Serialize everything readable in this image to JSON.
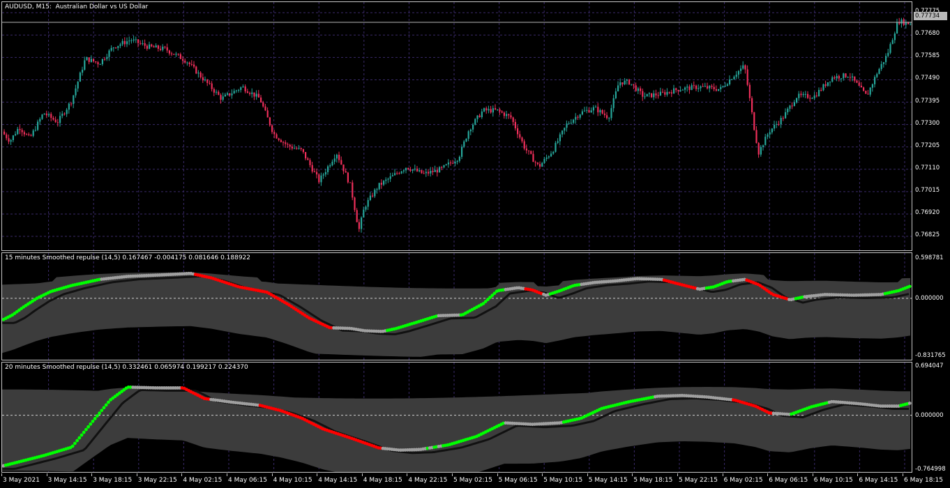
{
  "chart_window": {
    "symbol_caption": "AUDUSD, M15:  Australian Dollar vs US Dollar",
    "current_price": "0.77734",
    "price_scale": [
      "0.77775",
      "0.77680",
      "0.77585",
      "0.77490",
      "0.77395",
      "0.77300",
      "0.77205",
      "0.77110",
      "0.77015",
      "0.76920",
      "0.76825"
    ],
    "time_labels": [
      "3 May 2021",
      "3 May 14:15",
      "3 May 18:15",
      "3 May 22:15",
      "4 May 02:15",
      "4 May 06:15",
      "4 May 10:15",
      "4 May 14:15",
      "4 May 18:15",
      "4 May 22:15",
      "5 May 02:15",
      "5 May 06:15",
      "5 May 10:15",
      "5 May 14:15",
      "5 May 18:15",
      "5 May 22:15",
      "6 May 02:15",
      "6 May 06:15",
      "6 May 10:15",
      "6 May 14:15",
      "6 May 18:15"
    ],
    "colors": {
      "bull": "#26a69a",
      "bear": "#ef2f5a",
      "background": "#000000",
      "grid": "#3a2a6a",
      "band": "#3c3c3c",
      "up": "#00ff00",
      "down": "#ff0000",
      "neutral": "#a0a0a0"
    }
  },
  "indicator1": {
    "caption": "15 minutes Smoothed repulse (14,5) 0.167467 -0.004175 0.081646 0.188922",
    "scale_top": "0.598781",
    "scale_zero": "0.000000",
    "scale_bottom": "-0.831765"
  },
  "indicator2": {
    "caption": "20 minutes Smoothed repulse (14,5) 0.332461 0.065974 0.199217 0.224370",
    "scale_top": "0.694047",
    "scale_zero": "0.000000",
    "scale_bottom": "-0.764998"
  },
  "chart_data": [
    {
      "type": "candlestick",
      "title": "AUDUSD, M15:  Australian Dollar vs US Dollar",
      "ylim": [
        0.7676,
        0.7782
      ],
      "close_trajectory": [
        [
          0,
          0.7727
        ],
        [
          12,
          0.7723
        ],
        [
          25,
          0.7729
        ],
        [
          40,
          0.7724
        ],
        [
          60,
          0.7735
        ],
        [
          80,
          0.7731
        ],
        [
          100,
          0.774
        ],
        [
          120,
          0.7758
        ],
        [
          140,
          0.7756
        ],
        [
          160,
          0.7763
        ],
        [
          185,
          0.7766
        ],
        [
          210,
          0.7763
        ],
        [
          235,
          0.7762
        ],
        [
          265,
          0.7757
        ],
        [
          290,
          0.7749
        ],
        [
          315,
          0.7741
        ],
        [
          345,
          0.7746
        ],
        [
          370,
          0.7741
        ],
        [
          390,
          0.7726
        ],
        [
          410,
          0.7721
        ],
        [
          430,
          0.7719
        ],
        [
          455,
          0.7706
        ],
        [
          480,
          0.7718
        ],
        [
          500,
          0.7704
        ],
        [
          512,
          0.7685
        ],
        [
          520,
          0.7695
        ],
        [
          540,
          0.7704
        ],
        [
          560,
          0.7708
        ],
        [
          580,
          0.7712
        ],
        [
          605,
          0.7709
        ],
        [
          630,
          0.7711
        ],
        [
          655,
          0.7716
        ],
        [
          670,
          0.7728
        ],
        [
          690,
          0.7736
        ],
        [
          710,
          0.7736
        ],
        [
          730,
          0.7733
        ],
        [
          750,
          0.772
        ],
        [
          770,
          0.7712
        ],
        [
          790,
          0.7719
        ],
        [
          810,
          0.773
        ],
        [
          830,
          0.7735
        ],
        [
          850,
          0.7737
        ],
        [
          870,
          0.7733
        ],
        [
          885,
          0.7748
        ],
        [
          900,
          0.7748
        ],
        [
          920,
          0.7742
        ],
        [
          945,
          0.7743
        ],
        [
          970,
          0.7745
        ],
        [
          1000,
          0.7746
        ],
        [
          1030,
          0.7745
        ],
        [
          1050,
          0.7751
        ],
        [
          1065,
          0.7755
        ],
        [
          1078,
          0.773
        ],
        [
          1085,
          0.7718
        ],
        [
          1100,
          0.7727
        ],
        [
          1120,
          0.7733
        ],
        [
          1140,
          0.7742
        ],
        [
          1165,
          0.7742
        ],
        [
          1190,
          0.775
        ],
        [
          1215,
          0.7751
        ],
        [
          1240,
          0.7742
        ],
        [
          1255,
          0.7752
        ],
        [
          1270,
          0.776
        ],
        [
          1285,
          0.7774
        ],
        [
          1300,
          0.7773
        ]
      ]
    },
    {
      "type": "line",
      "title": "15 minutes Smoothed repulse (14,5) 0.167467 -0.004175 0.081646 0.188922",
      "ylim": [
        -0.831765,
        0.598781
      ],
      "main_line": [
        [
          0,
          -0.29
        ],
        [
          15,
          -0.22
        ],
        [
          30,
          -0.12
        ],
        [
          50,
          0.0
        ],
        [
          70,
          0.09
        ],
        [
          100,
          0.17
        ],
        [
          140,
          0.25
        ],
        [
          180,
          0.29
        ],
        [
          230,
          0.31
        ],
        [
          270,
          0.33
        ],
        [
          300,
          0.27
        ],
        [
          340,
          0.15
        ],
        [
          380,
          0.08
        ],
        [
          410,
          -0.08
        ],
        [
          440,
          -0.26
        ],
        [
          470,
          -0.39
        ],
        [
          500,
          -0.4
        ],
        [
          520,
          -0.43
        ],
        [
          545,
          -0.44
        ],
        [
          565,
          -0.4
        ],
        [
          590,
          -0.33
        ],
        [
          625,
          -0.23
        ],
        [
          660,
          -0.22
        ],
        [
          690,
          -0.07
        ],
        [
          710,
          0.1
        ],
        [
          740,
          0.14
        ],
        [
          760,
          0.11
        ],
        [
          780,
          0.04
        ],
        [
          800,
          0.1
        ],
        [
          820,
          0.17
        ],
        [
          850,
          0.21
        ],
        [
          880,
          0.23
        ],
        [
          910,
          0.26
        ],
        [
          945,
          0.25
        ],
        [
          970,
          0.19
        ],
        [
          1000,
          0.12
        ],
        [
          1020,
          0.15
        ],
        [
          1040,
          0.22
        ],
        [
          1065,
          0.25
        ],
        [
          1085,
          0.18
        ],
        [
          1105,
          0.05
        ],
        [
          1130,
          -0.02
        ],
        [
          1150,
          0.02
        ],
        [
          1180,
          0.05
        ],
        [
          1220,
          0.04
        ],
        [
          1260,
          0.05
        ],
        [
          1285,
          0.1
        ],
        [
          1302,
          0.16
        ]
      ]
    },
    {
      "type": "line",
      "title": "20 minutes Smoothed repulse (14,5) 0.332461 0.065974 0.199217 0.224370",
      "ylim": [
        -0.764998,
        0.694047
      ],
      "main_line": [
        [
          0,
          -0.67
        ],
        [
          30,
          -0.6
        ],
        [
          60,
          -0.53
        ],
        [
          100,
          -0.42
        ],
        [
          130,
          -0.08
        ],
        [
          155,
          0.2
        ],
        [
          180,
          0.37
        ],
        [
          220,
          0.36
        ],
        [
          260,
          0.36
        ],
        [
          290,
          0.22
        ],
        [
          330,
          0.17
        ],
        [
          370,
          0.13
        ],
        [
          400,
          0.06
        ],
        [
          430,
          -0.04
        ],
        [
          460,
          -0.18
        ],
        [
          500,
          -0.3
        ],
        [
          540,
          -0.43
        ],
        [
          570,
          -0.46
        ],
        [
          600,
          -0.45
        ],
        [
          640,
          -0.39
        ],
        [
          680,
          -0.28
        ],
        [
          720,
          -0.1
        ],
        [
          760,
          -0.12
        ],
        [
          800,
          -0.1
        ],
        [
          830,
          -0.04
        ],
        [
          860,
          0.09
        ],
        [
          900,
          0.18
        ],
        [
          940,
          0.25
        ],
        [
          975,
          0.26
        ],
        [
          1010,
          0.24
        ],
        [
          1050,
          0.2
        ],
        [
          1080,
          0.12
        ],
        [
          1100,
          0.03
        ],
        [
          1130,
          0.01
        ],
        [
          1160,
          0.11
        ],
        [
          1190,
          0.18
        ],
        [
          1230,
          0.15
        ],
        [
          1260,
          0.12
        ],
        [
          1285,
          0.12
        ],
        [
          1302,
          0.16
        ]
      ]
    }
  ]
}
